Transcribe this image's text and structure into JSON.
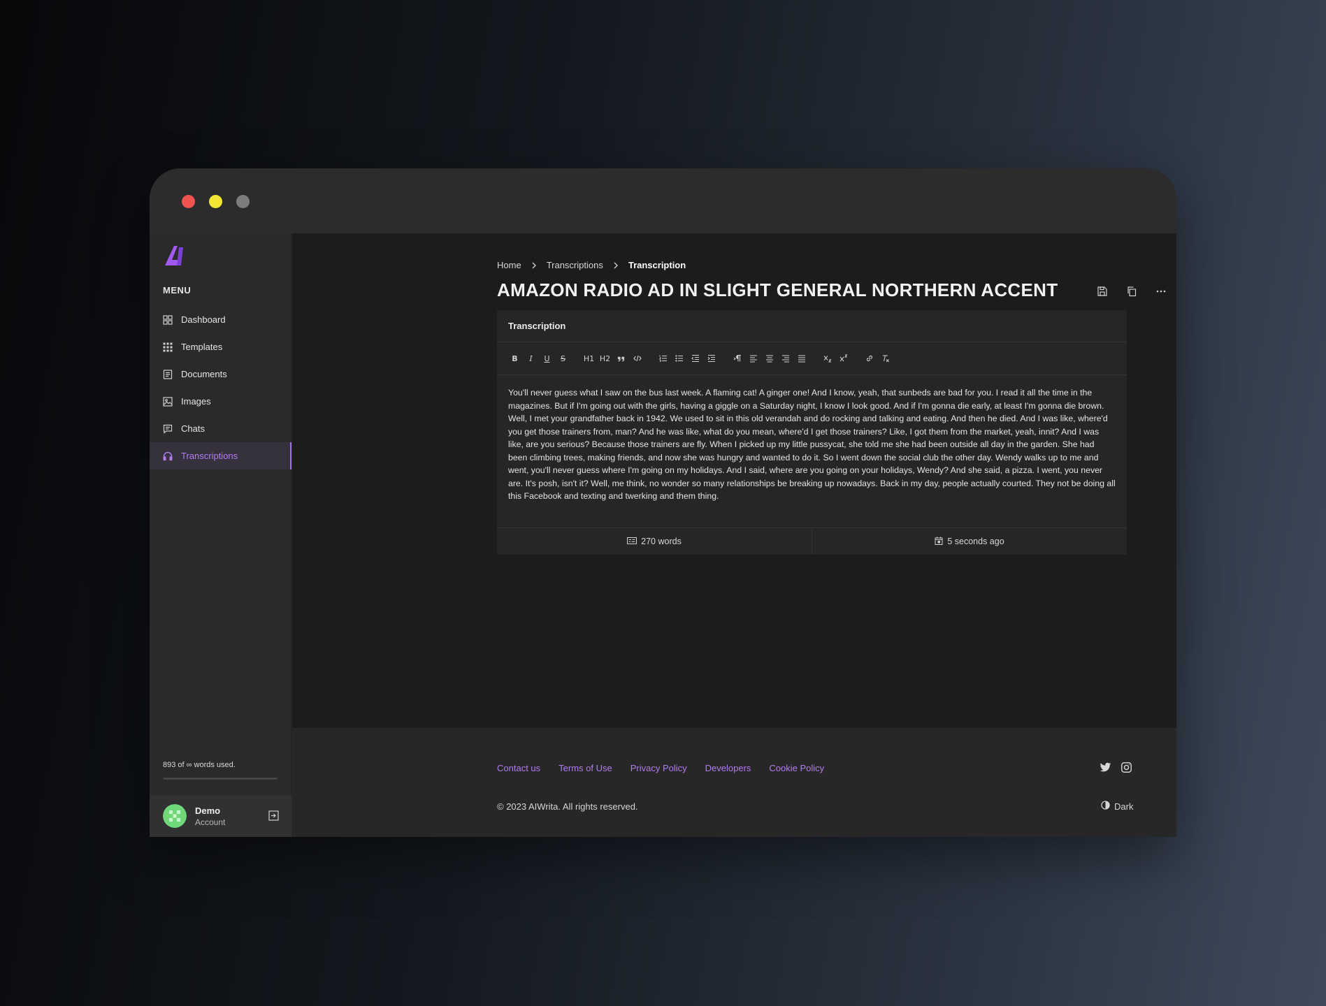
{
  "window": {
    "controls": [
      "close",
      "minimize",
      "maximize"
    ]
  },
  "sidebar": {
    "logo": "AIWrita-logo",
    "menu_label": "MENU",
    "items": [
      {
        "label": "Dashboard",
        "icon": "dashboard-icon"
      },
      {
        "label": "Templates",
        "icon": "grid-icon"
      },
      {
        "label": "Documents",
        "icon": "document-icon"
      },
      {
        "label": "Images",
        "icon": "image-icon"
      },
      {
        "label": "Chats",
        "icon": "chat-icon"
      },
      {
        "label": "Transcriptions",
        "icon": "headphones-icon",
        "active": true
      }
    ],
    "usage_text": "893 of ∞ words used.",
    "usage_fraction": 0,
    "account": {
      "name": "Demo",
      "subtitle": "Account"
    }
  },
  "breadcrumb": [
    "Home",
    "Transcriptions",
    "Transcription"
  ],
  "page_title": "AMAZON RADIO AD IN SLIGHT GENERAL NORTHERN ACCENT",
  "title_actions": [
    "save-icon",
    "copy-icon",
    "more-icon"
  ],
  "card": {
    "header": "Transcription",
    "toolbar": [
      "B",
      "I",
      "U",
      "S",
      "H1",
      "H2",
      "quote",
      "code",
      "ordered-list",
      "bullet-list",
      "indent-decrease",
      "indent-increase",
      "text-direction",
      "align-left",
      "align-center",
      "align-right",
      "align-justify",
      "subscript",
      "superscript",
      "link",
      "clear-format"
    ],
    "body": "You'll never guess what I saw on the bus last week. A flaming cat! A ginger one! And I know, yeah, that sunbeds are bad for you. I read it all the time in the magazines. But if I'm going out with the girls, having a giggle on a Saturday night, I know I look good. And if I'm gonna die early, at least I'm gonna die brown. Well, I met your grandfather back in 1942. We used to sit in this old verandah and do rocking and talking and eating. And then he died. And I was like, where'd you get those trainers from, man? And he was like, what do you mean, where'd I get those trainers? Like, I got them from the market, yeah, innit? And I was like, are you serious? Because those trainers are fly. When I picked up my little pussycat, she told me she had been outside all day in the garden. She had been climbing trees, making friends, and now she was hungry and wanted to do it. So I went down the social club the other day. Wendy walks up to me and went, you'll never guess where I'm going on my holidays. And I said, where are you going on your holidays, Wendy? And she said, a pizza. I went, you never are. It's posh, isn't it? Well, me think, no wonder so many relationships be breaking up nowadays. Back in my day, people actually courted. They not be doing all this Facebook and texting and twerking and them thing.",
    "word_count": "270 words",
    "updated": "5 seconds ago"
  },
  "footer": {
    "links": [
      "Contact us",
      "Terms of Use",
      "Privacy Policy",
      "Developers",
      "Cookie Policy"
    ],
    "social": [
      "twitter-icon",
      "instagram-icon"
    ],
    "copyright": "© 2023 AIWrita. All rights reserved.",
    "theme_label": "Dark"
  },
  "colors": {
    "accent": "#a66cf0",
    "background": "#1c1c1c",
    "sidebar": "#2a2a2a",
    "traffic_red": "#ef5350",
    "traffic_yellow": "#f3e733",
    "traffic_gray": "#7d7d7d"
  }
}
